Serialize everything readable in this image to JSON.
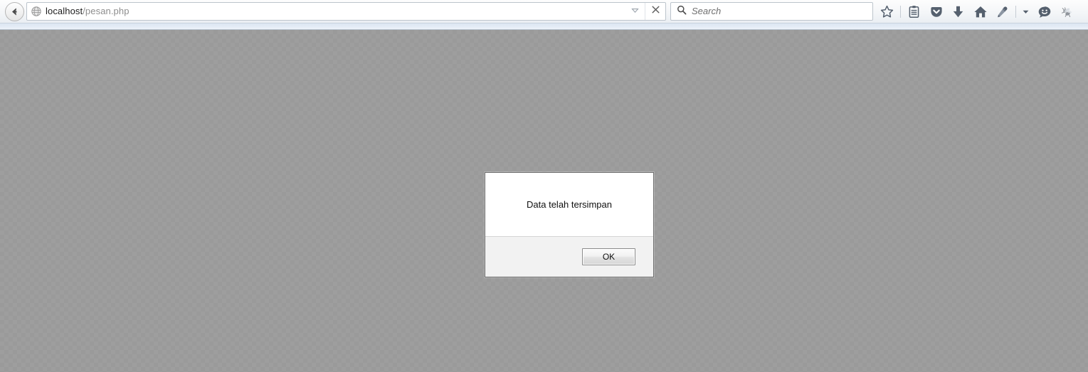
{
  "browser": {
    "back_button": "Back",
    "url": {
      "host": "localhost",
      "path": "/pesan.php",
      "full": "localhost/pesan.php"
    },
    "urlbar_buttons": [
      {
        "name": "autocomplete-dropdown",
        "icon": "chevron-down-icon"
      },
      {
        "name": "stop-button",
        "icon": "close-icon"
      }
    ],
    "search": {
      "placeholder": "Search",
      "icon": "search-icon",
      "value": ""
    },
    "toolbar_icons": [
      {
        "name": "bookmark-star-icon",
        "title": "Bookmark this page"
      },
      {
        "name": "reading-list-icon",
        "title": "Reading list"
      },
      {
        "name": "pocket-icon",
        "title": "Save to Pocket"
      },
      {
        "name": "downloads-icon",
        "title": "Downloads"
      },
      {
        "name": "home-icon",
        "title": "Home"
      },
      {
        "name": "eyedropper-icon",
        "title": "Eyedropper"
      },
      {
        "name": "chevron-down-icon",
        "title": "More tools"
      },
      {
        "name": "feedback-smiley-icon",
        "title": "Feedback"
      },
      {
        "name": "firebug-fly-icon",
        "title": "Firebug"
      }
    ]
  },
  "dialog": {
    "message": "Data telah tersimpan",
    "ok_label": "OK"
  },
  "colors": {
    "page_background": "#9a9a9a",
    "chrome_background": "#f4f6f8",
    "chrome_strip": "#dce6f2",
    "dialog_background": "#ffffff",
    "dialog_footer": "#f2f2f2",
    "dialog_border": "#6f6f6f",
    "icon_color": "#55606e"
  }
}
